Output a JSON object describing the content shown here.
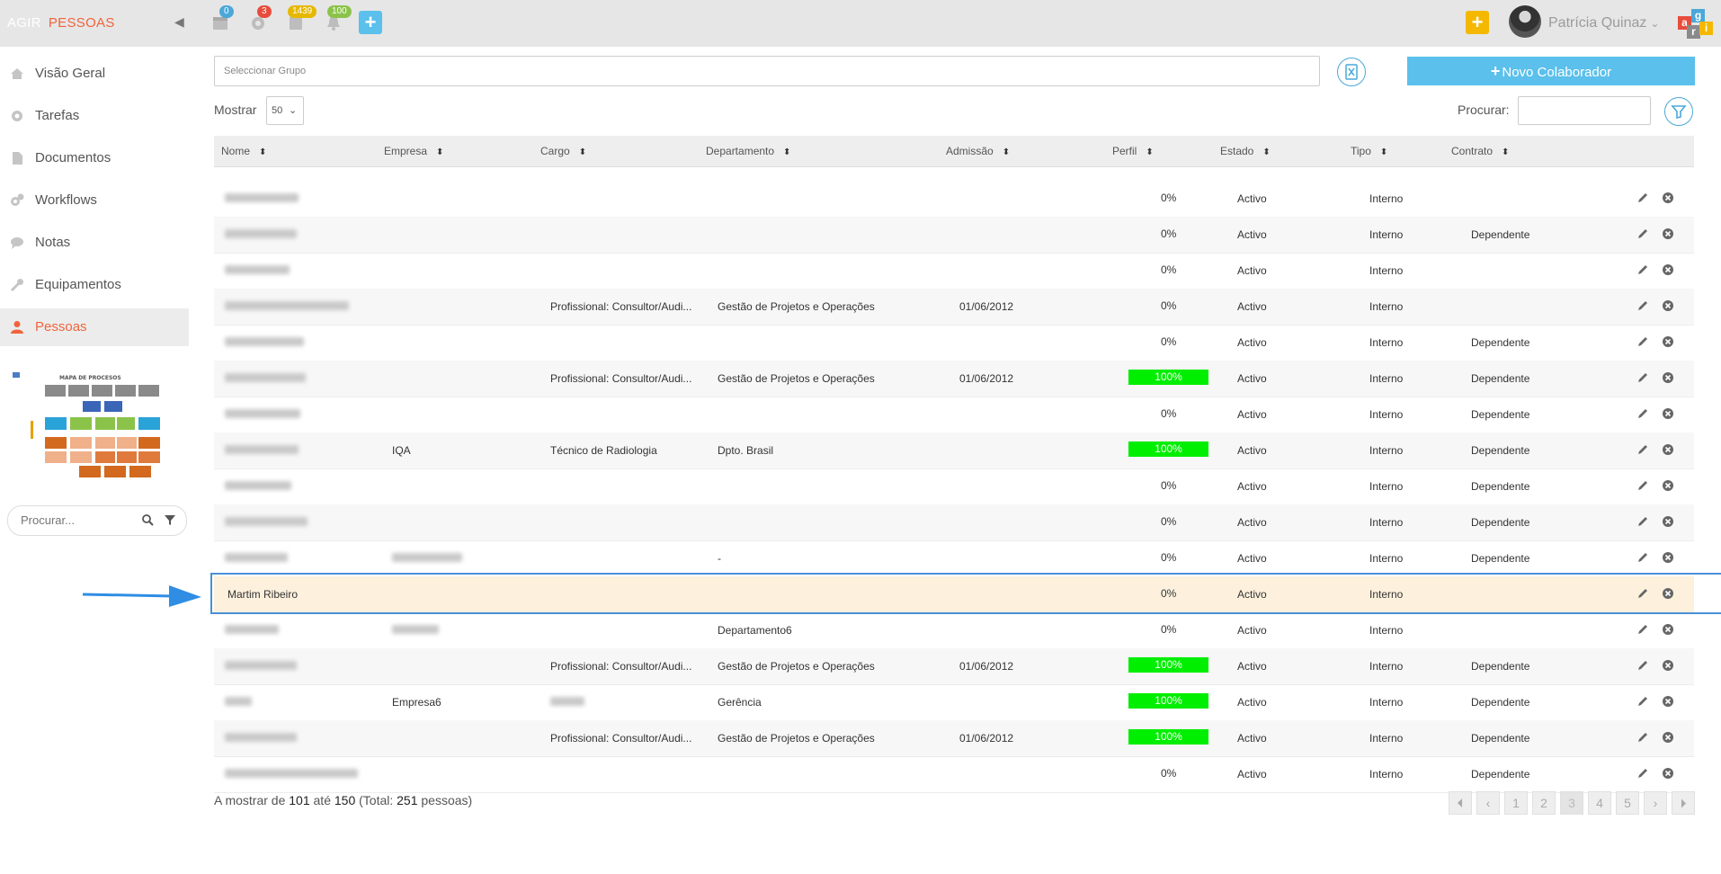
{
  "header": {
    "brand_primary": "AGIR",
    "brand_secondary": "PESSOAS",
    "badges": {
      "calendar": "0",
      "settings": "3",
      "tasks": "1439",
      "bell": "100"
    },
    "user_name": "Patrícia Quinaz"
  },
  "sidebar": {
    "items": [
      {
        "label": "Visão Geral",
        "icon": "home-icon"
      },
      {
        "label": "Tarefas",
        "icon": "gear-icon"
      },
      {
        "label": "Documentos",
        "icon": "document-icon"
      },
      {
        "label": "Workflows",
        "icon": "cogs-icon"
      },
      {
        "label": "Notas",
        "icon": "chat-icon"
      },
      {
        "label": "Equipamentos",
        "icon": "wrench-icon"
      },
      {
        "label": "Pessoas",
        "icon": "person-icon"
      }
    ],
    "process_map_title": "MAPA DE PROCESOS",
    "search_placeholder": "Procurar..."
  },
  "toolbar": {
    "group_placeholder": "Seleccionar Grupo",
    "new_button": "Novo Colaborador",
    "show_label": "Mostrar",
    "show_value": "50",
    "search_label": "Procurar:"
  },
  "table": {
    "columns": [
      "Nome",
      "Empresa",
      "Cargo",
      "Departamento",
      "Admissão",
      "Perfil",
      "Estado",
      "Tipo",
      "Contrato"
    ],
    "rows": [
      {
        "nome": "",
        "empresa": "",
        "cargo": "",
        "departamento": "",
        "admissao": "",
        "perfil": "0%",
        "estado": "Activo",
        "tipo": "Interno",
        "contrato": ""
      },
      {
        "nome": "",
        "empresa": "",
        "cargo": "",
        "departamento": "",
        "admissao": "",
        "perfil": "0%",
        "estado": "Activo",
        "tipo": "Interno",
        "contrato": "Dependente"
      },
      {
        "nome": "",
        "empresa": "",
        "cargo": "",
        "departamento": "",
        "admissao": "",
        "perfil": "0%",
        "estado": "Activo",
        "tipo": "Interno",
        "contrato": ""
      },
      {
        "nome": "",
        "empresa": "",
        "cargo": "Profissional: Consultor/Audi...",
        "departamento": "Gestão de Projetos e Operações",
        "admissao": "01/06/2012",
        "perfil": "0%",
        "estado": "Activo",
        "tipo": "Interno",
        "contrato": ""
      },
      {
        "nome": "",
        "empresa": "",
        "cargo": "",
        "departamento": "",
        "admissao": "",
        "perfil": "0%",
        "estado": "Activo",
        "tipo": "Interno",
        "contrato": "Dependente"
      },
      {
        "nome": "",
        "empresa": "",
        "cargo": "Profissional: Consultor/Audi...",
        "departamento": "Gestão de Projetos e Operações",
        "admissao": "01/06/2012",
        "perfil": "100%",
        "estado": "Activo",
        "tipo": "Interno",
        "contrato": "Dependente"
      },
      {
        "nome": "",
        "empresa": "",
        "cargo": "",
        "departamento": "",
        "admissao": "",
        "perfil": "0%",
        "estado": "Activo",
        "tipo": "Interno",
        "contrato": "Dependente"
      },
      {
        "nome": "",
        "empresa": "IQA",
        "cargo": "Técnico de Radiologia",
        "departamento": "Dpto. Brasil",
        "admissao": "",
        "perfil": "100%",
        "estado": "Activo",
        "tipo": "Interno",
        "contrato": "Dependente"
      },
      {
        "nome": "",
        "empresa": "",
        "cargo": "",
        "departamento": "",
        "admissao": "",
        "perfil": "0%",
        "estado": "Activo",
        "tipo": "Interno",
        "contrato": "Dependente"
      },
      {
        "nome": "",
        "empresa": "",
        "cargo": "",
        "departamento": "",
        "admissao": "",
        "perfil": "0%",
        "estado": "Activo",
        "tipo": "Interno",
        "contrato": "Dependente"
      },
      {
        "nome": "",
        "empresa": "",
        "cargo": "",
        "departamento": "-",
        "admissao": "",
        "perfil": "0%",
        "estado": "Activo",
        "tipo": "Interno",
        "contrato": "Dependente"
      },
      {
        "nome": "Martim Ribeiro",
        "empresa": "",
        "cargo": "",
        "departamento": "",
        "admissao": "",
        "perfil": "0%",
        "estado": "Activo",
        "tipo": "Interno",
        "contrato": ""
      },
      {
        "nome": "",
        "empresa": "",
        "cargo": "",
        "departamento": "Departamento6",
        "admissao": "",
        "perfil": "0%",
        "estado": "Activo",
        "tipo": "Interno",
        "contrato": ""
      },
      {
        "nome": "",
        "empresa": "",
        "cargo": "Profissional: Consultor/Audi...",
        "departamento": "Gestão de Projetos e Operações",
        "admissao": "01/06/2012",
        "perfil": "100%",
        "estado": "Activo",
        "tipo": "Interno",
        "contrato": "Dependente"
      },
      {
        "nome": "",
        "empresa": "Empresa6",
        "cargo": "",
        "departamento": "Gerência",
        "admissao": "",
        "perfil": "100%",
        "estado": "Activo",
        "tipo": "Interno",
        "contrato": "Dependente"
      },
      {
        "nome": "",
        "empresa": "",
        "cargo": "Profissional: Consultor/Audi...",
        "departamento": "Gestão de Projetos e Operações",
        "admissao": "01/06/2012",
        "perfil": "100%",
        "estado": "Activo",
        "tipo": "Interno",
        "contrato": "Dependente"
      },
      {
        "nome": "",
        "empresa": "",
        "cargo": "",
        "departamento": "",
        "admissao": "",
        "perfil": "0%",
        "estado": "Activo",
        "tipo": "Interno",
        "contrato": "Dependente"
      }
    ]
  },
  "footer": {
    "prefix": "A mostrar de",
    "from": "101",
    "mid": "até",
    "to": "150",
    "total_prefix": "(Total:",
    "total": "251",
    "total_suffix": "pessoas)"
  },
  "pagination": {
    "first": "⏴",
    "prev": "‹",
    "pages": [
      "1",
      "2",
      "3",
      "4",
      "5"
    ],
    "current_page": "3",
    "next": "›",
    "last": "⏵"
  },
  "colors": {
    "accent_blue": "#5bc0eb",
    "brand_orange": "#f0643c",
    "perfil_green": "#00ee00",
    "highlight_row": "#fdf1dd"
  }
}
